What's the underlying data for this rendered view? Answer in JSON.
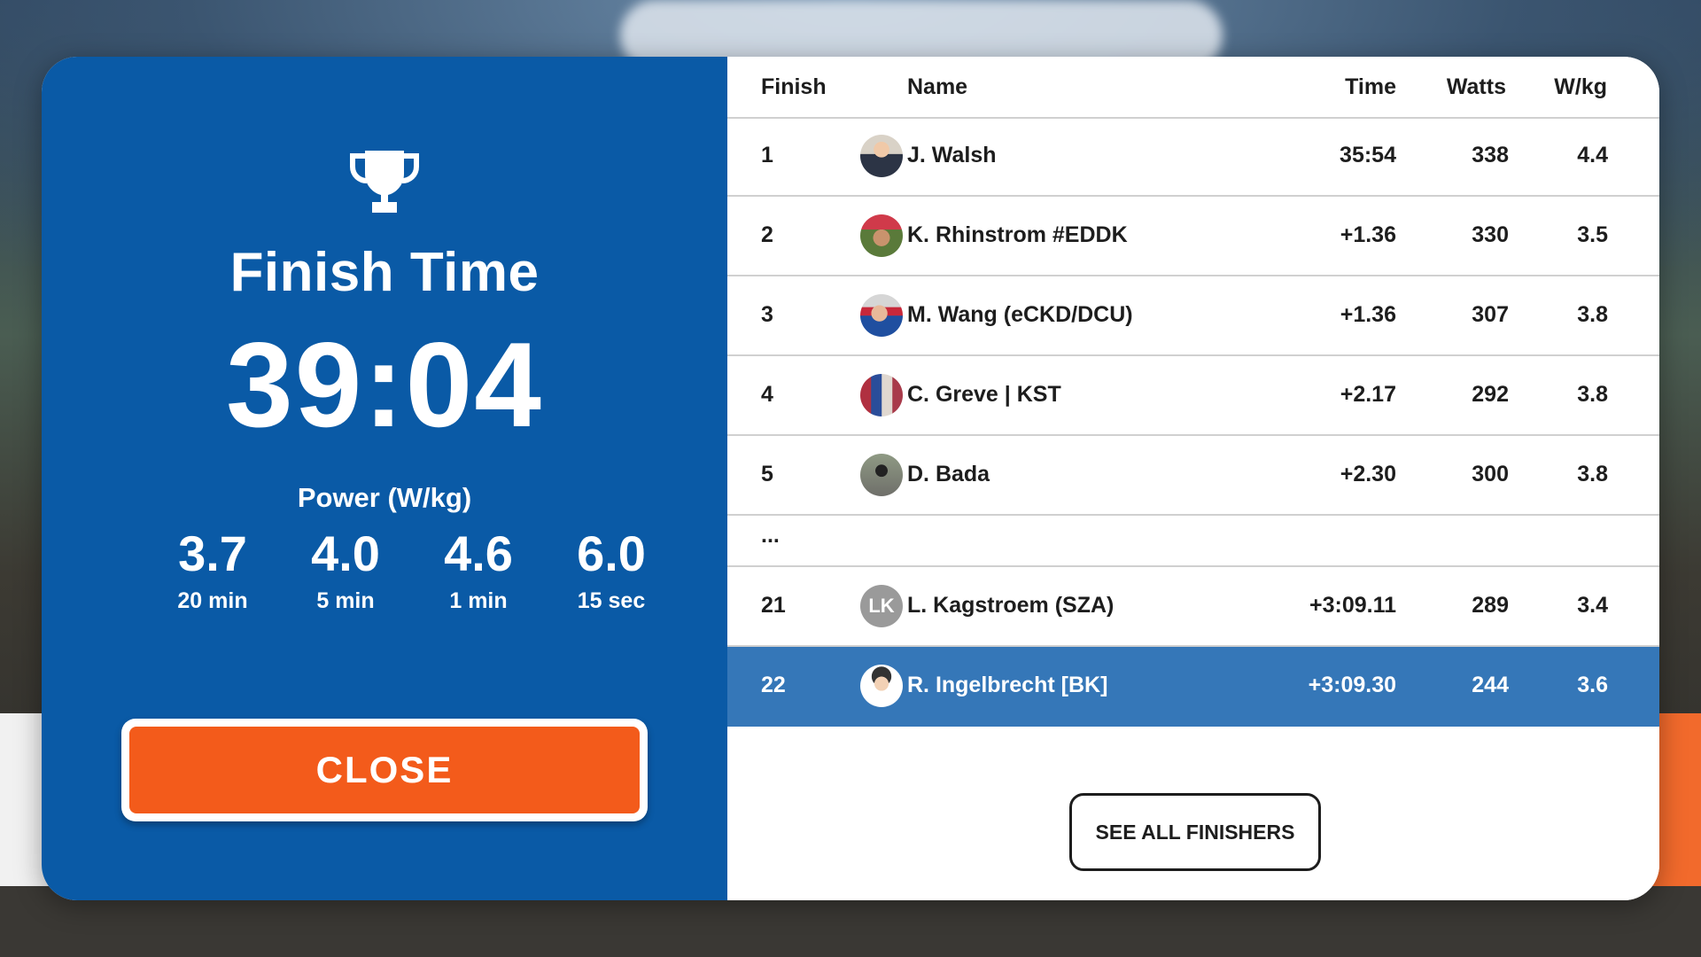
{
  "summary": {
    "title": "Finish Time",
    "finish_time": "39:04",
    "power_label": "Power (W/kg)",
    "power": [
      {
        "value": "3.7",
        "unit": "20 min"
      },
      {
        "value": "4.0",
        "unit": "5 min"
      },
      {
        "value": "4.6",
        "unit": "1 min"
      },
      {
        "value": "6.0",
        "unit": "15 sec"
      }
    ],
    "close_label": "CLOSE"
  },
  "results": {
    "headers": {
      "finish": "Finish",
      "name": "Name",
      "time": "Time",
      "watts": "Watts",
      "wkg": "W/kg"
    },
    "rows": [
      {
        "finish": "1",
        "name": "J. Walsh",
        "time": "35:54",
        "watts": "338",
        "wkg": "4.4"
      },
      {
        "finish": "2",
        "name": "K. Rhinstrom #EDDK",
        "time": "+1.36",
        "watts": "330",
        "wkg": "3.5"
      },
      {
        "finish": "3",
        "name": "M. Wang (eCKD/DCU)",
        "time": "+1.36",
        "watts": "307",
        "wkg": "3.8"
      },
      {
        "finish": "4",
        "name": "C. Greve | KST",
        "time": "+2.17",
        "watts": "292",
        "wkg": "3.8"
      },
      {
        "finish": "5",
        "name": "D. Bada",
        "time": "+2.30",
        "watts": "300",
        "wkg": "3.8"
      }
    ],
    "ellipsis": "...",
    "lower_rows": [
      {
        "finish": "21",
        "name": "L. Kagstroem (SZA)",
        "time": "+3:09.11",
        "watts": "289",
        "wkg": "3.4",
        "initials": "LK"
      },
      {
        "finish": "22",
        "name": "R. Ingelbrecht [BK]",
        "time": "+3:09.30",
        "watts": "244",
        "wkg": "3.6"
      }
    ],
    "see_all_label": "SEE ALL FINISHERS"
  },
  "colors": {
    "panel_blue": "#0a5aa6",
    "highlight_blue": "#3577b8",
    "close_orange": "#f35b1b"
  }
}
